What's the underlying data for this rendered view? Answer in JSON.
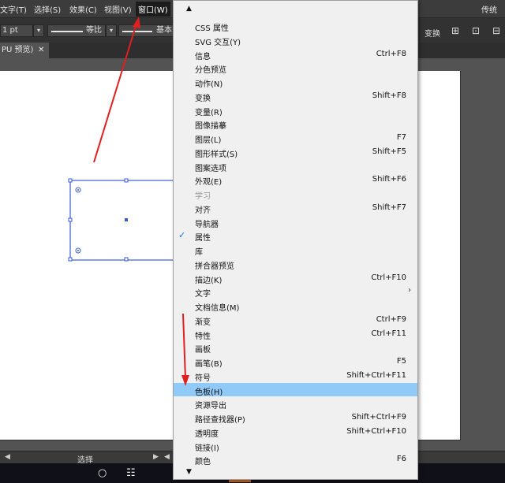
{
  "menubar": {
    "items": [
      "文字(T)",
      "选择(S)",
      "效果(C)",
      "视图(V)",
      "窗口(W)"
    ],
    "right_text": "传统"
  },
  "controlbar": {
    "stroke_weight": "1 pt",
    "stroke_profile": "等比",
    "brush_label": "基本",
    "transform_label": "变换"
  },
  "tab": {
    "title": "PU 预览)",
    "close": "✕"
  },
  "status": {
    "label": "选择"
  },
  "menu": {
    "items": [
      {
        "label": "CSS 属性",
        "shortcut": ""
      },
      {
        "label": "SVG 交互(Y)",
        "shortcut": ""
      },
      {
        "label": "信息",
        "shortcut": "Ctrl+F8"
      },
      {
        "label": "分色预览",
        "shortcut": ""
      },
      {
        "label": "动作(N)",
        "shortcut": ""
      },
      {
        "label": "变换",
        "shortcut": "Shift+F8"
      },
      {
        "label": "变量(R)",
        "shortcut": ""
      },
      {
        "label": "图像描摹",
        "shortcut": ""
      },
      {
        "label": "图层(L)",
        "shortcut": "F7"
      },
      {
        "label": "图形样式(S)",
        "shortcut": "Shift+F5"
      },
      {
        "label": "图案选项",
        "shortcut": ""
      },
      {
        "label": "外观(E)",
        "shortcut": "Shift+F6"
      },
      {
        "label": "学习",
        "shortcut": "",
        "disabled": true
      },
      {
        "label": "对齐",
        "shortcut": "Shift+F7"
      },
      {
        "label": "导航器",
        "shortcut": ""
      },
      {
        "label": "属性",
        "shortcut": "",
        "checked": true
      },
      {
        "label": "库",
        "shortcut": ""
      },
      {
        "label": "拼合器预览",
        "shortcut": ""
      },
      {
        "label": "描边(K)",
        "shortcut": "Ctrl+F10"
      },
      {
        "label": "文字",
        "shortcut": "",
        "submenu": true
      },
      {
        "label": "文档信息(M)",
        "shortcut": ""
      },
      {
        "label": "渐变",
        "shortcut": "Ctrl+F9"
      },
      {
        "label": "特性",
        "shortcut": "Ctrl+F11"
      },
      {
        "label": "画板",
        "shortcut": ""
      },
      {
        "label": "画笔(B)",
        "shortcut": "F5"
      },
      {
        "label": "符号",
        "shortcut": "Shift+Ctrl+F11"
      },
      {
        "label": "色板(H)",
        "shortcut": "",
        "highlighted": true
      },
      {
        "label": "资源导出",
        "shortcut": ""
      },
      {
        "label": "路径查找器(P)",
        "shortcut": "Shift+Ctrl+F9"
      },
      {
        "label": "透明度",
        "shortcut": "Shift+Ctrl+F10"
      },
      {
        "label": "链接(I)",
        "shortcut": ""
      },
      {
        "label": "颜色",
        "shortcut": "F6"
      }
    ]
  },
  "colors": {
    "annotation_arrow": "#e02020",
    "selection_blue": "#3b5bd6",
    "menu_highlight": "#91c9f7"
  },
  "icons": [
    "check-icon",
    "submenu-arrow-icon",
    "scroll-up-icon",
    "scroll-down-icon",
    "cortana-circle-icon",
    "task-view-icon"
  ]
}
